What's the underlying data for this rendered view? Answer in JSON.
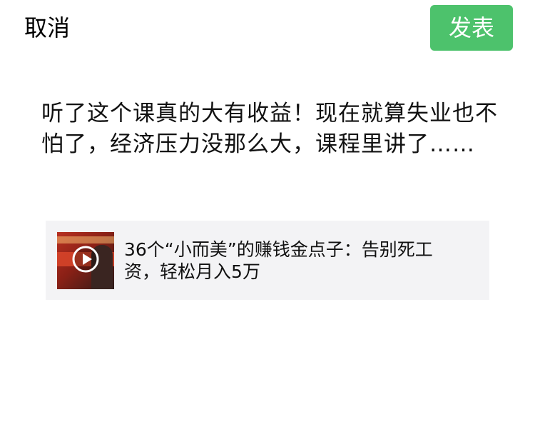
{
  "header": {
    "cancel_label": "取消",
    "post_label": "发表"
  },
  "post": {
    "text": "听了这个课真的大有收益！现在就算失业也不怕了，经济压力没那么大，课程里讲了……"
  },
  "link_card": {
    "title": "36个“小而美”的赚钱金点子：告别死工资，轻松月入5万",
    "thumbnail_icon": "play-icon"
  },
  "colors": {
    "accent": "#4dc26c",
    "card_background": "#f3f3f5"
  }
}
